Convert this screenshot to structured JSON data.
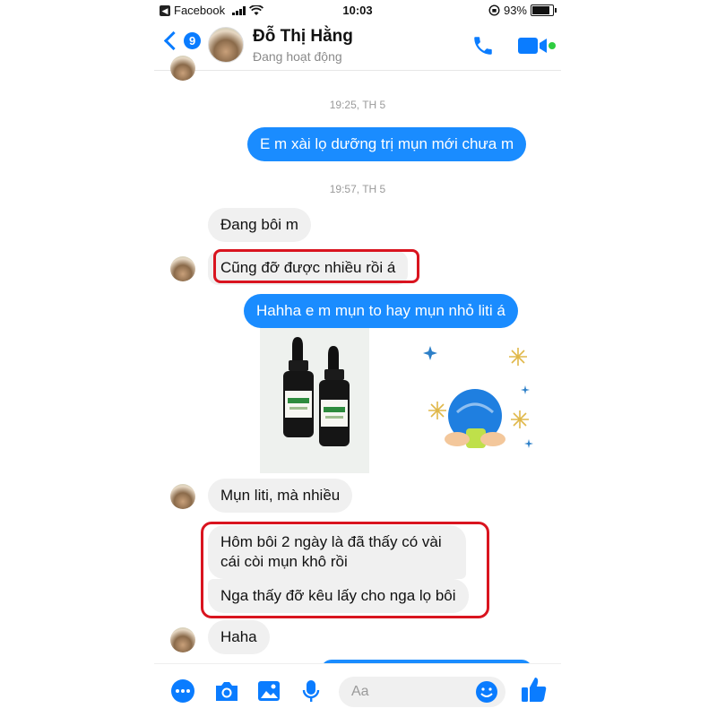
{
  "status_bar": {
    "back_app": "Facebook",
    "time": "10:03",
    "battery": "93%",
    "battery_level": 0.93
  },
  "header": {
    "back_count": "9",
    "contact_name": "Đỗ Thị Hằng",
    "contact_status": "Đang hoạt động"
  },
  "chat": {
    "timestamps": [
      "19:25, TH 5",
      "19:57, TH 5"
    ],
    "messages": [
      {
        "from": "me",
        "text": "E m xài lọ dưỡng trị mụn mới chưa m"
      },
      {
        "from": "them",
        "text": "Đang bôi m"
      },
      {
        "from": "them",
        "text": "Cũng đỡ được nhiều rồi á"
      },
      {
        "from": "me",
        "text": "Hahha e m mụn to hay mụn nhỏ liti á"
      },
      {
        "from": "them",
        "text": "Mụn liti, mà nhiều"
      },
      {
        "from": "them",
        "text": "Hôm bôi 2 ngày là đã thấy có vài cái còi mụn khô rồi"
      },
      {
        "from": "them",
        "text": "Nga thấy đỡ kêu lấy cho nga lọ bôi"
      },
      {
        "from": "them",
        "text": "Haha"
      }
    ]
  },
  "composer": {
    "placeholder": "Aa"
  },
  "colors": {
    "accent": "#0a7cff",
    "outgoing_bubble": "#1a8cff",
    "incoming_bubble": "#f0f0f0",
    "highlight": "#d9141f"
  },
  "icons": [
    "back-chevron-icon",
    "phone-icon",
    "video-icon",
    "more-icon",
    "camera-icon",
    "gallery-icon",
    "microphone-icon",
    "emoji-icon",
    "thumbs-up-icon"
  ]
}
